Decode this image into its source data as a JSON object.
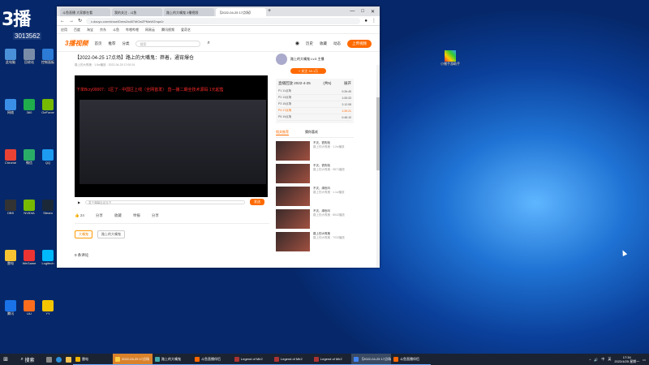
{
  "desktop": {
    "logo_text": "3播",
    "logo_number": "3013562",
    "icons": [
      {
        "label": "此电脑",
        "color": "#4a90d9"
      },
      {
        "label": "回收站",
        "color": "#7a8da8"
      },
      {
        "label": "控制面板",
        "color": "#2c7bd6"
      },
      {
        "label": "网络",
        "color": "#3b8ee6"
      },
      {
        "label": "360",
        "color": "#1fae4b"
      },
      {
        "label": "GeForce",
        "color": "#76b900"
      },
      {
        "label": "Chrome",
        "color": "#e94235"
      },
      {
        "label": "微信",
        "color": "#2aae67"
      },
      {
        "label": "QQ",
        "color": "#1d9bf0"
      },
      {
        "label": "OBS",
        "color": "#333"
      },
      {
        "label": "NVIDIA",
        "color": "#76b900"
      },
      {
        "label": "Steam",
        "color": "#1b2838"
      },
      {
        "label": "雷电",
        "color": "#f7c331"
      },
      {
        "label": "WeGame",
        "color": "#e33"
      },
      {
        "label": "Logitech",
        "color": "#00b8fc"
      },
      {
        "label": "腾讯",
        "color": "#1a73e8"
      },
      {
        "label": "UU",
        "color": "#fb6d1d"
      },
      {
        "label": "YY",
        "color": "#f5c400"
      }
    ],
    "right_app_label": "小猪手游助手"
  },
  "browser": {
    "tabs": [
      {
        "title": "斗鱼直播 大家都在看"
      },
      {
        "title": "我的关注 - 斗鱼"
      },
      {
        "title": "路上的大嘴鬼 3播视频"
      },
      {
        "title": "【2022-04-25 17点场】"
      }
    ],
    "new_tab": "+",
    "win_buttons": [
      "—",
      "□",
      "✕"
    ],
    "url": "v.douyu.com/show/Dmw2xd87dtOaZPMaWZnqa1r",
    "bookmarks": [
      "应用",
      "百度",
      "淘宝",
      "京东",
      "斗鱼",
      "哔哩哔哩",
      "网易云",
      "腾讯视频",
      "爱奇艺"
    ]
  },
  "site": {
    "logo": "3播视频",
    "nav": [
      "首页",
      "推荐",
      "分类"
    ],
    "search_placeholder": "搜索",
    "header_links": [
      "历史",
      "收藏",
      "动态"
    ],
    "upload": "上传视频",
    "video": {
      "title": "【2022-04-25 17点场】路上的大嘴鬼：莽着，通宵爆仓",
      "meta": "路上的大嘴鬼 · 1.5w播放 · 2022-04-25 17:00:24",
      "overlay": "下单Bcry00007：1区了 - 中国区上线（全网首发）  直—播二期全技术源码 1元起售",
      "danmaku_placeholder": "发个弹幕见证当下",
      "send": "发送"
    },
    "actions": [
      "24",
      "分享",
      "收藏",
      "举报",
      "分享"
    ],
    "tags": [
      "大嘴鬼",
      "路上的大嘴鬼"
    ],
    "comments_label": "0 条评论",
    "uploader": {
      "name": "路上的大嘴鬼  Lv.5  主播",
      "follow": "+ 关注  33.1万"
    },
    "playlist": {
      "title": "直播回放 2022-4-25",
      "count": "(共5)",
      "more": "展开",
      "items": [
        {
          "label": "P1 11点场",
          "time": "0:26:45"
        },
        {
          "label": "P2 13点场",
          "time": "1:05:33"
        },
        {
          "label": "P3 15点场",
          "time": "2:12:08"
        },
        {
          "label": "P4 17点场",
          "time": "1:39:21"
        },
        {
          "label": "P5 19点场",
          "time": "0:48:10"
        }
      ]
    },
    "rtabs": [
      "相关推荐",
      "猜你喜欢"
    ],
    "recs": [
      {
        "title": "不灭，铁狗找",
        "meta": "路上的大嘴鬼 · 1.2w播放"
      },
      {
        "title": "不灭，铁狗找",
        "meta": "路上的大嘴鬼 · 9871播放"
      },
      {
        "title": "不灭，绿色叫",
        "meta": "路上的大嘴鬼 · 1.1w播放"
      },
      {
        "title": "不灭，绿色叫",
        "meta": "路上的大嘴鬼 · 8542播放"
      },
      {
        "title": "路上的大嘴鬼",
        "meta": "路上的大嘴鬼 · 7033播放"
      }
    ]
  },
  "taskbar": {
    "search": "搜索",
    "apps": [
      {
        "label": "雷电",
        "color": "#f0b400"
      },
      {
        "label": "2022-04-25 17点场",
        "color": "#ffcc44",
        "style": "orange"
      },
      {
        "label": "路上的大嘴鬼",
        "color": "#4aa"
      },
      {
        "label": "斗鱼直播伴侣",
        "color": "#f60"
      },
      {
        "label": "Legend of Mir2",
        "color": "#a33"
      },
      {
        "label": "Legend of Mir2",
        "color": "#a33"
      },
      {
        "label": "Legend of Mir2",
        "color": "#a33"
      },
      {
        "label": "【2022-04-25 17点场】",
        "color": "#4285f4",
        "style": "active"
      },
      {
        "label": "斗鱼直播伴侣",
        "color": "#f60"
      }
    ],
    "tray": [
      "^",
      "中",
      "英"
    ],
    "time": "17:34",
    "date": "2022/4/25 星期一"
  }
}
